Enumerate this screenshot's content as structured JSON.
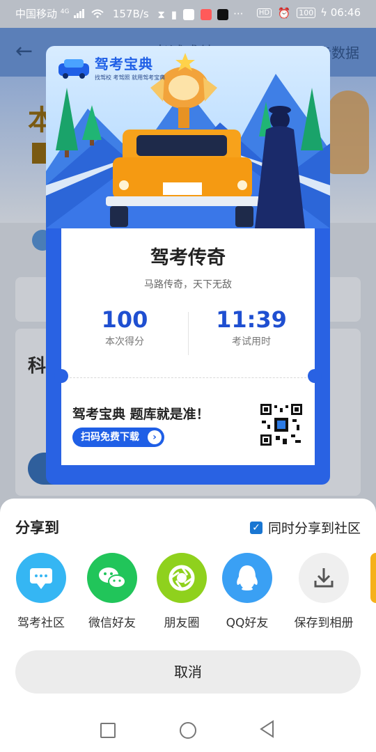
{
  "status_bar": {
    "carrier": "中国移动",
    "network": "4G",
    "speed": "157B/s",
    "battery": "100",
    "time": "06:46"
  },
  "background": {
    "title": "考试成绩",
    "sync": "同步数据",
    "big_char": "本",
    "section": "科"
  },
  "card": {
    "brand_name": "驾考宝典",
    "brand_tagline": "找驾校 考驾照 就用驾考宝典",
    "title": "驾考传奇",
    "subtitle": "马路传奇，天下无敌",
    "score_value": "100",
    "score_label": "本次得分",
    "time_value": "11:39",
    "time_label": "考试用时",
    "promo_text": "驾考宝典 题库就是准！",
    "scan_button": "扫码免费下载"
  },
  "share_sheet": {
    "title": "分享到",
    "sync_label": "同时分享到社区",
    "sync_checked": true,
    "targets": [
      {
        "label": "驾考社区",
        "icon": "community-icon",
        "color": "#35b6f3"
      },
      {
        "label": "微信好友",
        "icon": "wechat-icon",
        "color": "#21c55a"
      },
      {
        "label": "朋友圈",
        "icon": "moments-icon",
        "color": "#8fd11d"
      },
      {
        "label": "QQ好友",
        "icon": "qq-icon",
        "color": "#3aa0f4"
      },
      {
        "label": "保存到相册",
        "icon": "download-icon",
        "color": "#efefef"
      }
    ],
    "cancel": "取消"
  },
  "colors": {
    "card_blue": "#2962e3",
    "accent_blue": "#1f4fd1"
  }
}
